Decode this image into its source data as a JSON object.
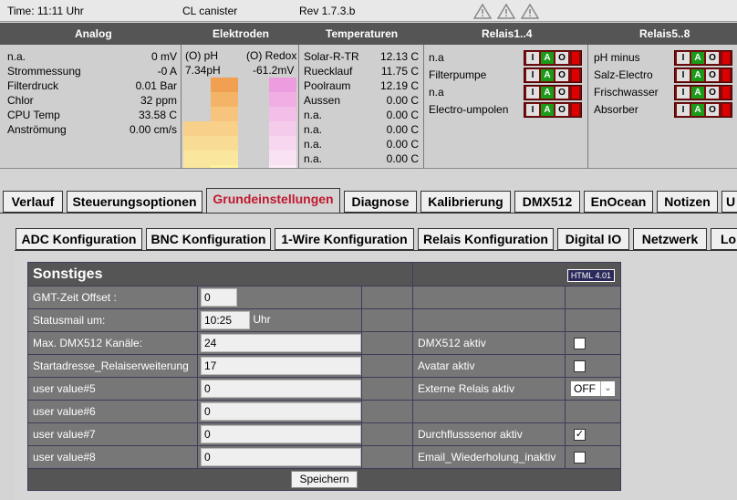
{
  "topbar": {
    "time": "Time: 11:11 Uhr",
    "device": "CL canister",
    "rev": "Rev 1.7.3.b"
  },
  "headers": {
    "analog": "Analog",
    "elektroden": "Elektroden",
    "temperaturen": "Temperaturen",
    "relais1": "Relais1..4",
    "relais2": "Relais5..8"
  },
  "analog": [
    {
      "label": "n.a.",
      "value": "0 mV"
    },
    {
      "label": "Strommessung",
      "value": "-0 A"
    },
    {
      "label": "Filterdruck",
      "value": "0.01 Bar"
    },
    {
      "label": "Chlor",
      "value": "32 ppm"
    },
    {
      "label": "CPU Temp",
      "value": "33.58 C"
    },
    {
      "label": "Anströmung",
      "value": "0.00 cm/s"
    }
  ],
  "elektroden": {
    "ph_label": "(O) pH",
    "redox_label": "(O) Redox",
    "ph_value": "7.34pH",
    "redox_value": "-61.2mV"
  },
  "temperaturen": [
    {
      "label": "Solar-R-TR",
      "value": "12.13 C"
    },
    {
      "label": "Ruecklauf",
      "value": "11.75 C"
    },
    {
      "label": "Poolraum",
      "value": "12.19 C"
    },
    {
      "label": "Aussen",
      "value": "0.00 C"
    },
    {
      "label": "n.a.",
      "value": "0.00 C"
    },
    {
      "label": "n.a.",
      "value": "0.00 C"
    },
    {
      "label": "n.a.",
      "value": "0.00 C"
    },
    {
      "label": "n.a.",
      "value": "0.00 C"
    }
  ],
  "relais_letters": {
    "i": "I",
    "a": "A",
    "o": "O"
  },
  "relais1": [
    {
      "label": "n.a",
      "state": "A"
    },
    {
      "label": "Filterpumpe",
      "state": "A"
    },
    {
      "label": "n.a",
      "state": "A"
    },
    {
      "label": "Electro-umpolen",
      "state": "A"
    }
  ],
  "relais2": [
    {
      "label": "pH minus",
      "state": "A"
    },
    {
      "label": "Salz-Electro",
      "state": "A"
    },
    {
      "label": "Frischwasser",
      "state": "A"
    },
    {
      "label": "Absorber",
      "state": "A"
    }
  ],
  "main_tabs": [
    "Verlauf",
    "Steuerungsoptionen",
    "Grundeinstellungen",
    "Diagnose",
    "Kalibrierung",
    "DMX512",
    "EnOcean",
    "Notizen",
    "U"
  ],
  "active_main_tab": "Grundeinstellungen",
  "sub_tabs": [
    "ADC Konfiguration",
    "BNC Konfiguration",
    "1-Wire Konfiguration",
    "Relais Konfiguration",
    "Digital IO",
    "Netzwerk",
    "Lo"
  ],
  "form": {
    "title": "Sonstiges",
    "badge": "HTML 4.01",
    "gmt_label": "GMT-Zeit Offset :",
    "gmt_value": "0",
    "statusmail_label": "Statusmail um:",
    "statusmail_value": "10:25",
    "statusmail_unit": "Uhr",
    "dmx_label": "Max. DMX512 Kanäle:",
    "dmx_value": "24",
    "start_label": "Startadresse_Relaiserweiterung",
    "start_value": "17",
    "uv5_label": "user value#5",
    "uv5_value": "0",
    "uv6_label": "user value#6",
    "uv6_value": "0",
    "uv7_label": "user value#7",
    "uv7_value": "0",
    "uv8_label": "user value#8",
    "uv8_value": "0",
    "dmx_aktiv_label": "DMX512 aktiv",
    "avatar_label": "Avatar aktiv",
    "externe_label": "Externe Relais aktiv",
    "externe_value": "OFF",
    "durchfluss_label": "Durchflusssenor aktiv",
    "email_label": "Email_Wiederholung_inaktiv",
    "save_label": "Speichern"
  },
  "checkboxes": {
    "dmx_aktiv": false,
    "avatar_aktiv": false,
    "durchfluss_aktiv": true,
    "email_inaktiv": false
  },
  "colors": {
    "header_bg": "#555555",
    "active_tab": "#c0182e",
    "relais_on": "#1a9b1a",
    "relais_box": "#7a0d0d"
  }
}
